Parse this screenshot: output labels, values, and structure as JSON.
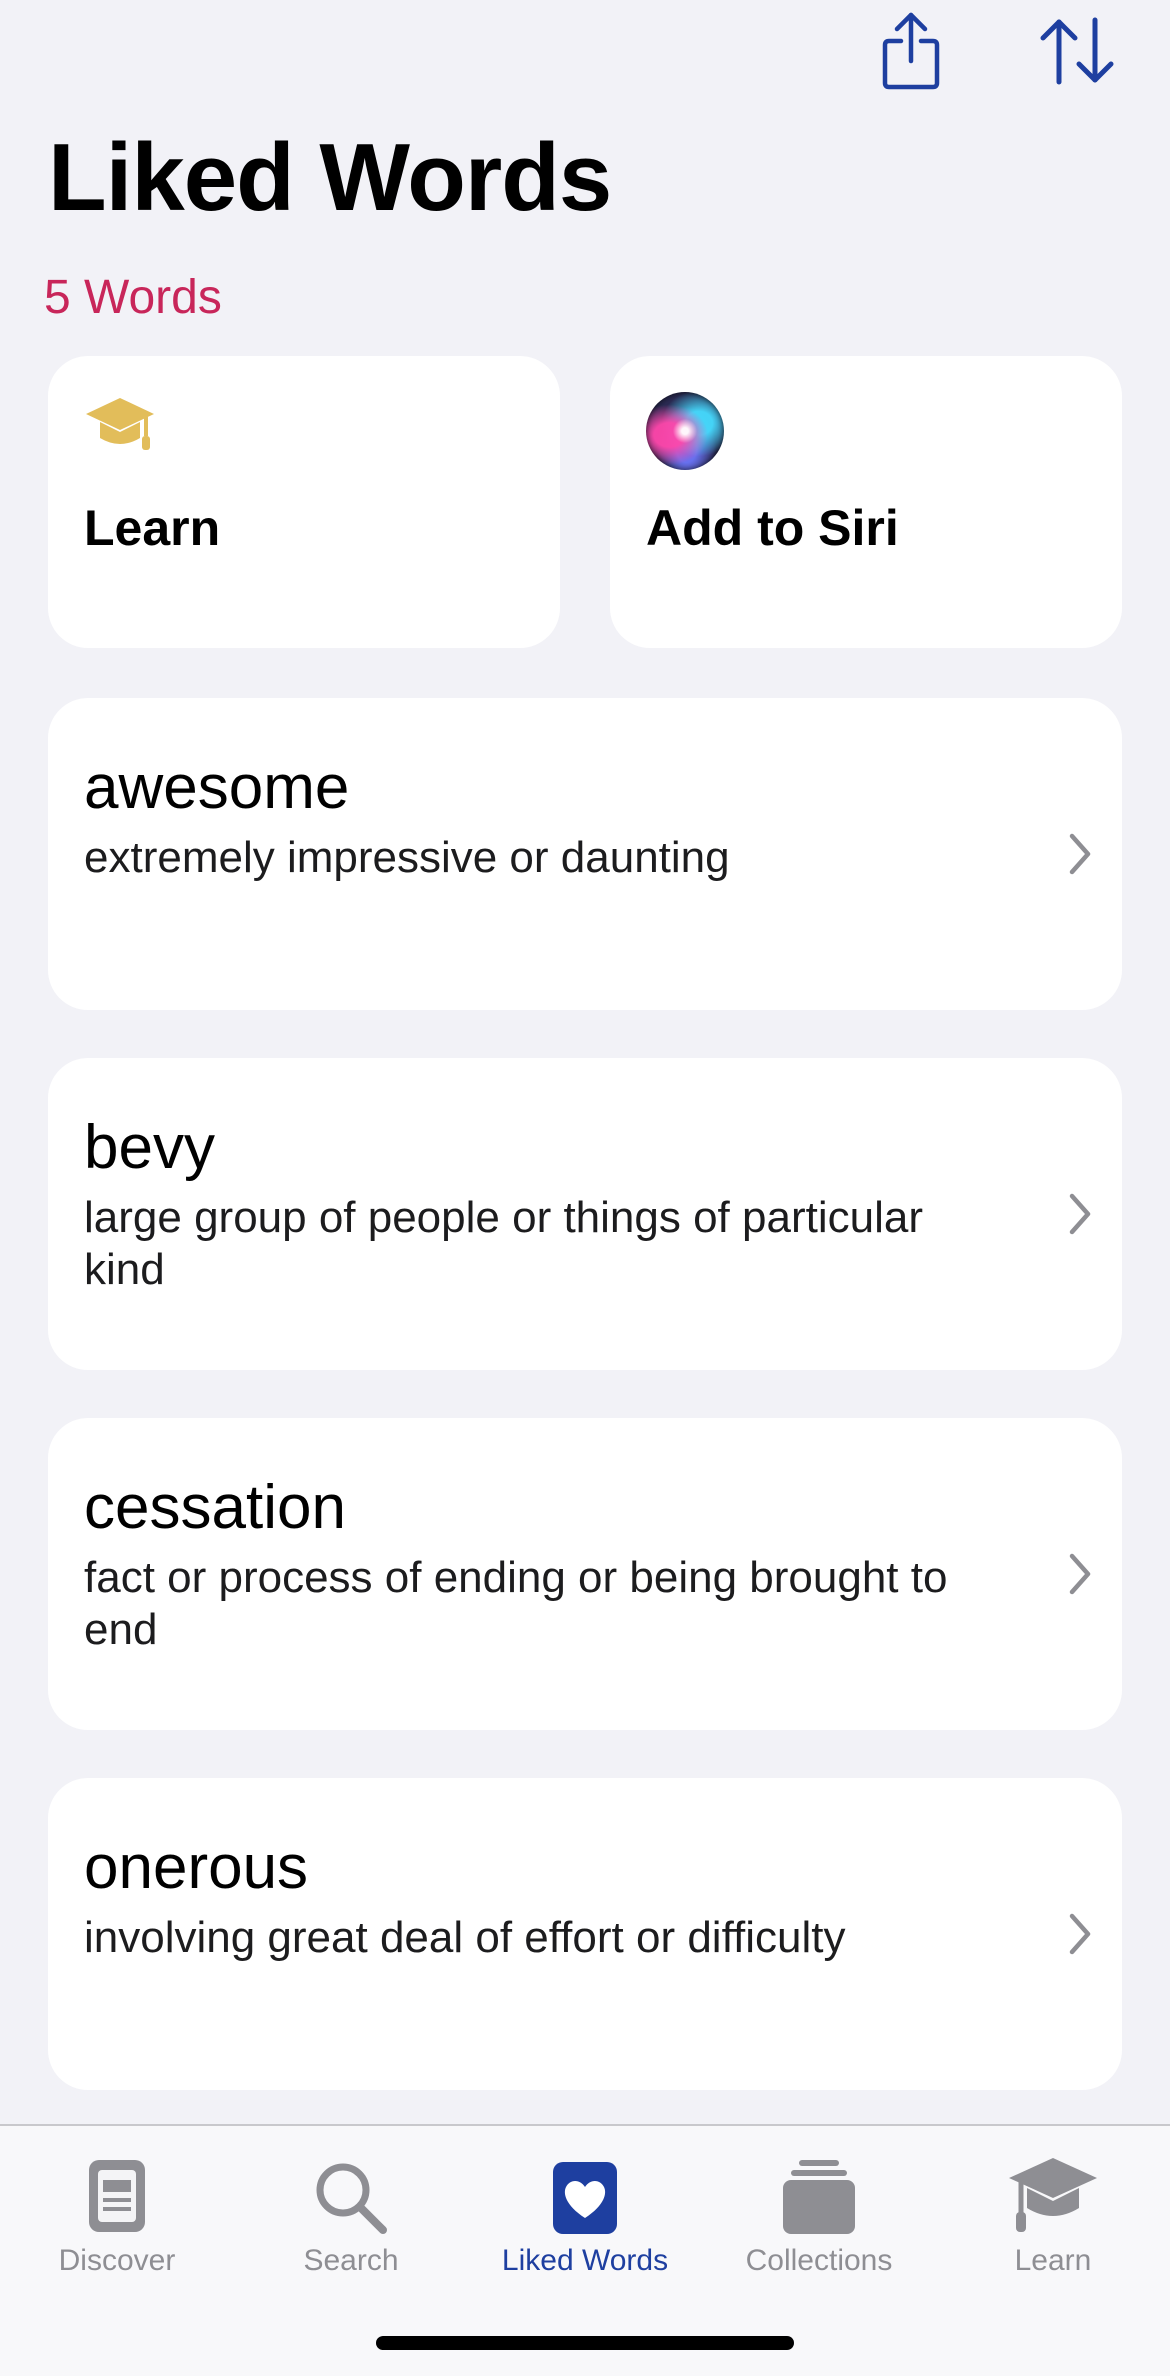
{
  "header": {
    "title": "Liked Words",
    "count_text": "5 Words",
    "share_icon": "share-icon",
    "sort_icon": "sort-icon",
    "accent_color": "#1e3fa0",
    "count_color": "#c8265a"
  },
  "actions": [
    {
      "label": "Learn",
      "icon": "graduation-cap-icon"
    },
    {
      "label": "Add to Siri",
      "icon": "siri-icon"
    }
  ],
  "words": [
    {
      "word": "awesome",
      "definition": "extremely impressive or daunting"
    },
    {
      "word": "bevy",
      "definition": "large group of people or things of particular kind"
    },
    {
      "word": "cessation",
      "definition": "fact or process of ending or being brought to end"
    },
    {
      "word": "onerous",
      "definition": "involving great deal of effort or difficulty"
    }
  ],
  "tabbar": {
    "active": "Liked Words",
    "items": [
      {
        "label": "Discover",
        "icon": "discover-icon"
      },
      {
        "label": "Search",
        "icon": "search-icon"
      },
      {
        "label": "Liked Words",
        "icon": "heart-icon"
      },
      {
        "label": "Collections",
        "icon": "collections-icon"
      },
      {
        "label": "Learn",
        "icon": "graduation-cap-icon"
      }
    ]
  }
}
